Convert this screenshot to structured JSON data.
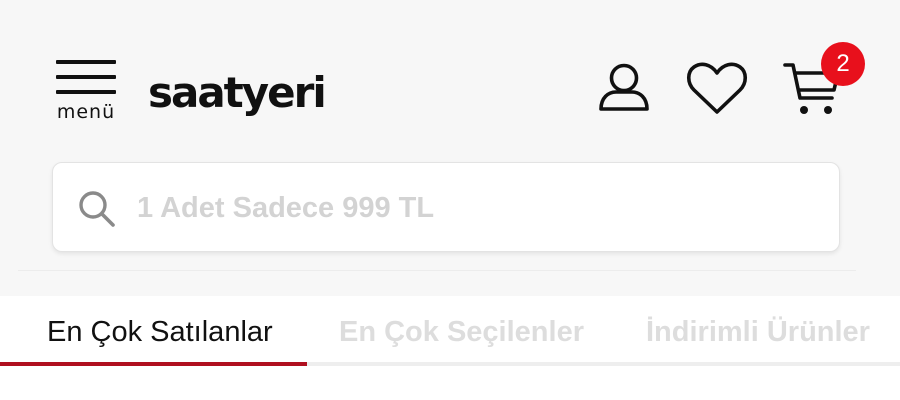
{
  "header": {
    "menu_label": "menü",
    "logo_text": "saatyeri",
    "cart_count": "2",
    "icons": {
      "menu": "hamburger-icon",
      "account": "user-icon",
      "favorites": "heart-icon",
      "cart": "cart-icon",
      "search": "search-icon"
    }
  },
  "search": {
    "placeholder": "1 Adet Sadece 999 TL",
    "value": ""
  },
  "tabs": [
    {
      "label": "En Çok Satılanlar",
      "active": true
    },
    {
      "label": "En Çok Seçilenler",
      "active": false
    },
    {
      "label": "İndirimli Ürünler",
      "active": false
    }
  ],
  "colors": {
    "accent": "#b01020",
    "badge": "#e8101c",
    "header_bg": "#f7f7f7",
    "inactive_tab": "#dddddd"
  }
}
